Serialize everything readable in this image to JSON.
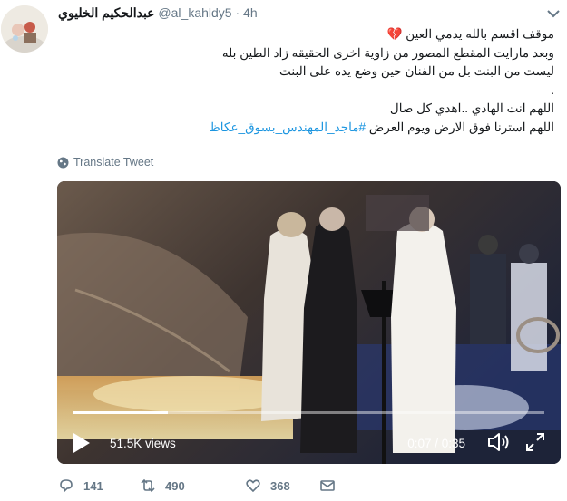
{
  "tweet": {
    "display_name": "عبدالحكيم الخليوي",
    "handle": "@al_kahldy5",
    "separator": "·",
    "time": "4h",
    "lines": [
      "موقف اقسم بالله يدمي العين 💔",
      "وبعد مارايت المقطع المصور من زاوية اخرى الحقيقه زاد الطين بله",
      "ليست من البنت بل من الفنان حين وضع يده على البنت",
      ".",
      "اللهم انت الهادي ..اهدي كل ضال"
    ],
    "last_line_text": "اللهم استرنا فوق الارض ويوم العرض ",
    "hashtag": "#ماجد_المهندس_بسوق_عكاظ",
    "translate_label": "Translate Tweet"
  },
  "video": {
    "views": "51.5K views",
    "time_display": "0:07 / 0:35",
    "progress_fraction": 0.2
  },
  "actions": {
    "replies": "141",
    "retweets": "490",
    "likes": "368"
  },
  "colors": {
    "link": "#1b95e0",
    "muted": "#657786",
    "text": "#14171a"
  }
}
